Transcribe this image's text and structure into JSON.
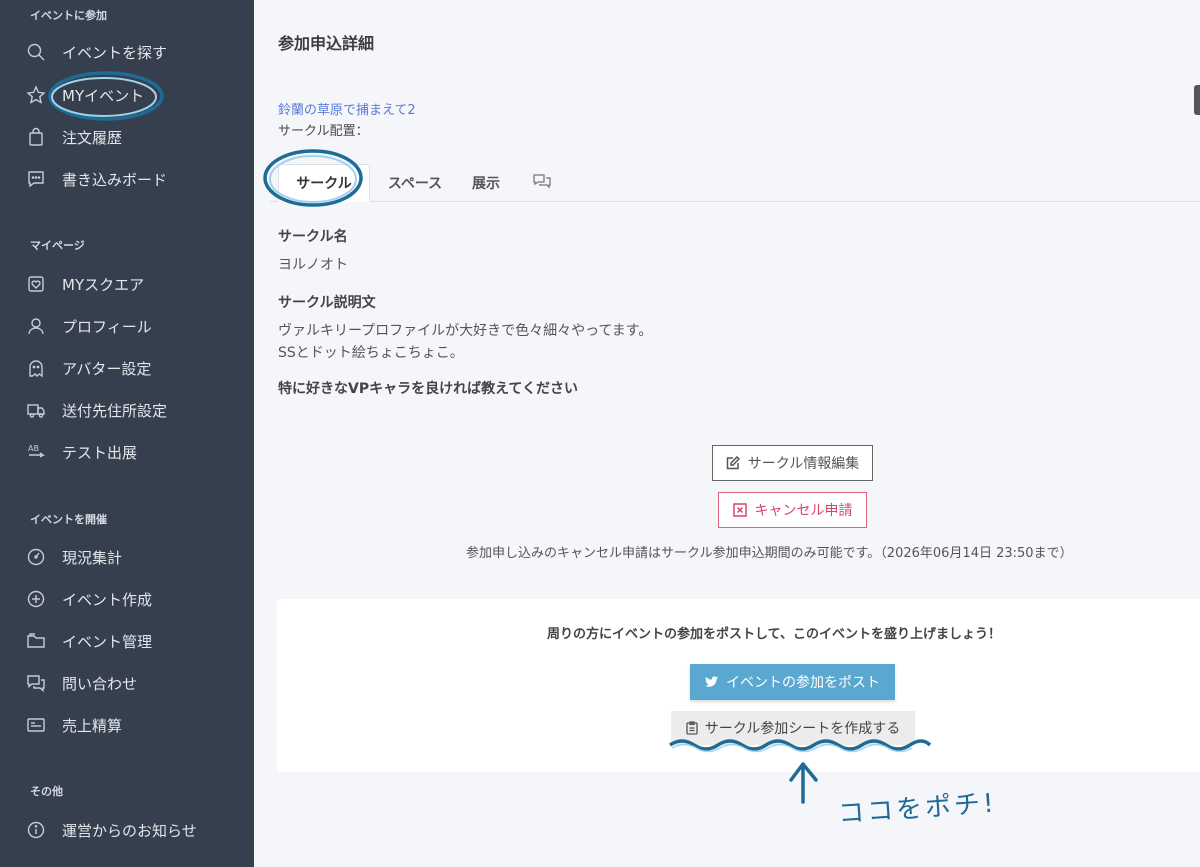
{
  "sidebar": {
    "sections": {
      "join": "イベントに参加",
      "mypage": "マイページ",
      "host": "イベントを開催",
      "other": "その他"
    },
    "items": [
      {
        "label": "イベントを探す",
        "icon": "search-icon"
      },
      {
        "label": "MYイベント",
        "icon": "star-icon"
      },
      {
        "label": "注文履歴",
        "icon": "bag-icon"
      },
      {
        "label": "書き込みボード",
        "icon": "chat-icon"
      },
      {
        "label": "MYスクエア",
        "icon": "heart-square-icon"
      },
      {
        "label": "プロフィール",
        "icon": "user-icon"
      },
      {
        "label": "アバター設定",
        "icon": "ghost-icon"
      },
      {
        "label": "送付先住所設定",
        "icon": "truck-icon"
      },
      {
        "label": "テスト出展",
        "icon": "ab-icon"
      },
      {
        "label": "現況集計",
        "icon": "dashboard-icon"
      },
      {
        "label": "イベント作成",
        "icon": "plus-circle-icon"
      },
      {
        "label": "イベント管理",
        "icon": "folder-icon"
      },
      {
        "label": "問い合わせ",
        "icon": "comments-icon"
      },
      {
        "label": "売上精算",
        "icon": "card-icon"
      },
      {
        "label": "運営からのお知らせ",
        "icon": "info-icon"
      }
    ]
  },
  "main": {
    "title": "参加申込詳細",
    "event_name": "鈴蘭の草原で捕まえて2",
    "placement_label": "サークル配置：",
    "tabs": [
      "サークル",
      "スペース",
      "展示"
    ],
    "circle_name_label": "サークル名",
    "circle_name": "ヨルノオト",
    "description_label": "サークル説明文",
    "description_lines": [
      "ヴァルキリープロファイルが大好きで色々細々やってます。",
      "SSとドット絵ちょこちょこ。"
    ],
    "question_label": "特に好きなVPキャラを良ければ教えてください",
    "edit_button": "サークル情報編集",
    "cancel_button": "キャンセル申請",
    "cancel_note": "参加申し込みのキャンセル申請はサークル参加申込期間のみ可能です。（2026年06月14日 23:50まで）",
    "share": {
      "message": "周りの方にイベントの参加をポストして、このイベントを盛り上げましょう！",
      "post_button": "イベントの参加をポスト",
      "sheet_button": "サークル参加シートを作成する"
    }
  },
  "annotation": {
    "handwritten_note": "ココをポチ!",
    "color": "#1f6a97"
  }
}
